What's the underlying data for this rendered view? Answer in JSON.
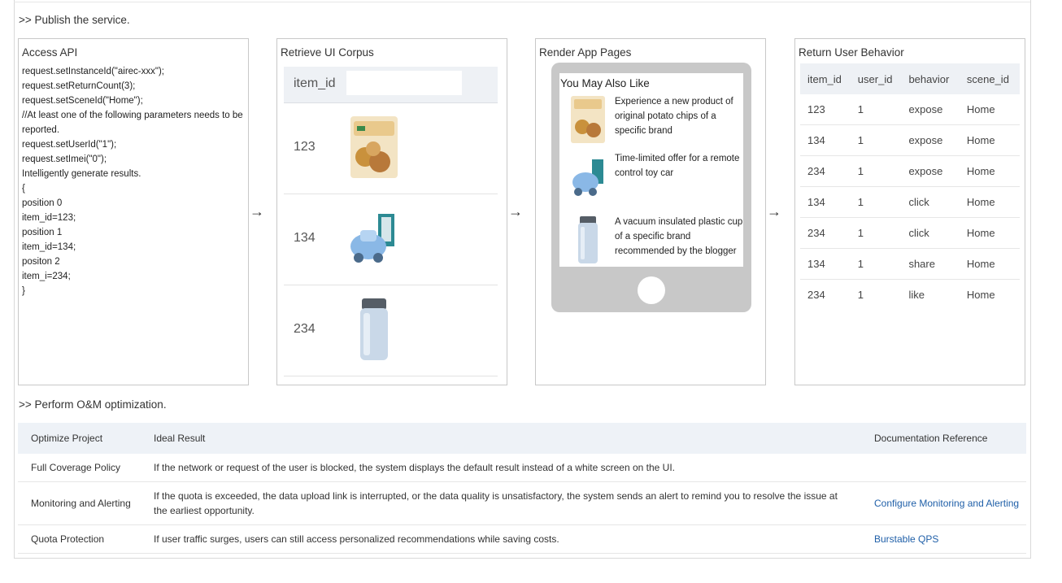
{
  "sections": {
    "publish": ">> Publish the service.",
    "om": ">> Perform O&M optimization."
  },
  "panels": {
    "access_api": {
      "title": "Access API",
      "code_lines": [
        "request.setInstanceId(\"airec-xxx\");",
        "request.setReturnCount(3);",
        "request.setSceneId(\"Home\");",
        "//At least one of the following parameters needs to be reported.",
        "request.setUserId(\"1\");",
        "request.setImei(\"0\");",
        "Intelligently generate results.",
        "{",
        "position 0",
        "item_id=123;",
        "position 1",
        "item_id=134;",
        "positon 2",
        "item_i=234;",
        "}"
      ]
    },
    "corpus": {
      "title": "Retrieve UI Corpus",
      "header": "item_id",
      "rows": [
        {
          "id": "123",
          "thumb": "potato-chips-icon"
        },
        {
          "id": "134",
          "thumb": "toy-car-icon"
        },
        {
          "id": "234",
          "thumb": "water-cup-icon"
        }
      ]
    },
    "render": {
      "title": "Render App Pages",
      "phone_title": "You May Also Like",
      "items": [
        {
          "text": "Experience a new product of original potato chips of a specific brand",
          "thumb": "potato-chips-icon"
        },
        {
          "text": "Time-limited offer for a remote control toy car",
          "thumb": "toy-car-icon"
        },
        {
          "text": "A vacuum insulated plastic cup of a specific brand recommended by the blogger",
          "thumb": "water-cup-icon"
        }
      ]
    },
    "behavior": {
      "title": "Return User Behavior",
      "columns": [
        "item_id",
        "user_id",
        "behavior",
        "scene_id"
      ],
      "rows": [
        [
          "123",
          "1",
          "expose",
          "Home"
        ],
        [
          "134",
          "1",
          "expose",
          "Home"
        ],
        [
          "234",
          "1",
          "expose",
          "Home"
        ],
        [
          "134",
          "1",
          "click",
          "Home"
        ],
        [
          "234",
          "1",
          "click",
          "Home"
        ],
        [
          "134",
          "1",
          "share",
          "Home"
        ],
        [
          "234",
          "1",
          "like",
          "Home"
        ]
      ]
    }
  },
  "arrows": [
    "→",
    "→",
    "→"
  ],
  "om_table": {
    "columns": [
      "Optimize Project",
      "Ideal Result",
      "Documentation Reference"
    ],
    "rows": [
      {
        "project": "Full Coverage Policy",
        "result": "If the network or request of the user is blocked, the system displays the default result instead of a white screen on the UI.",
        "ref": ""
      },
      {
        "project": "Monitoring and Alerting",
        "result": "If the quota is exceeded, the data upload link is interrupted, or the data quality is unsatisfactory, the system sends an alert to remind you to resolve the issue at the earliest opportunity.",
        "ref": "Configure Monitoring and Alerting"
      },
      {
        "project": "Quota Protection",
        "result": "If user traffic surges, users can still access personalized recommendations while saving costs.",
        "ref": "Burstable QPS"
      }
    ]
  },
  "colors": {
    "link": "#1f5fa8",
    "header_bg": "#eef2f7",
    "phone_body": "#c8c8c8"
  }
}
